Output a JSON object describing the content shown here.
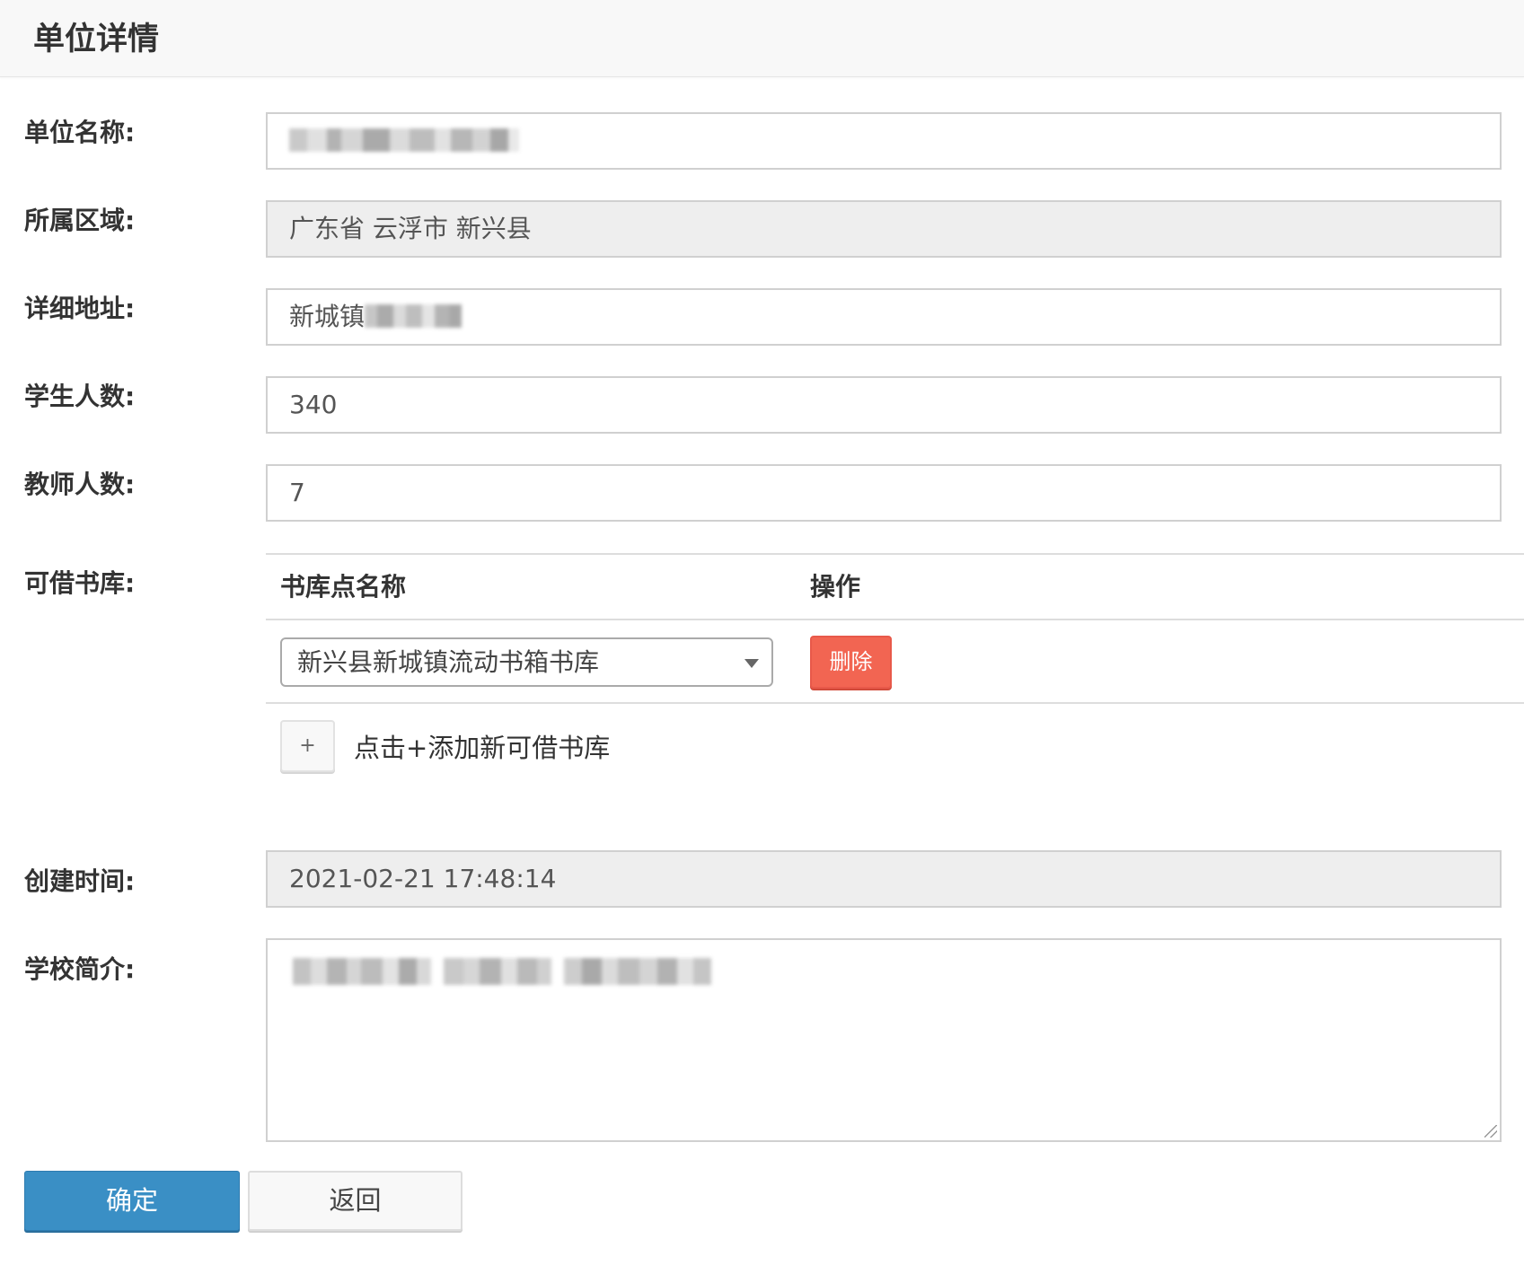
{
  "header": {
    "title": "单位详情"
  },
  "form": {
    "unit_name": {
      "label": "单位名称:",
      "value": ""
    },
    "region": {
      "label": "所属区域:",
      "value": "广东省 云浮市 新兴县"
    },
    "address": {
      "label": "详细地址:",
      "value": "新城镇"
    },
    "students": {
      "label": "学生人数:",
      "value": "340"
    },
    "teachers": {
      "label": "教师人数:",
      "value": "7"
    },
    "library": {
      "label": "可借书库:",
      "columns": [
        "书库点名称",
        "操作"
      ],
      "rows": [
        {
          "library_name": "新兴县新城镇流动书箱书库",
          "action_label": "删除"
        }
      ],
      "add_button_label": "+",
      "add_hint": "点击+添加新可借书库"
    },
    "created_time": {
      "label": "创建时间:",
      "value": "2021-02-21 17:48:14"
    },
    "intro": {
      "label": "学校简介:",
      "value": ""
    }
  },
  "actions": {
    "confirm_label": "确定",
    "back_label": "返回"
  },
  "colors": {
    "primary": "#3a8fc5",
    "danger": "#f26552",
    "readonly_bg": "#eeeeee",
    "header_bg": "#f8f8f8"
  }
}
